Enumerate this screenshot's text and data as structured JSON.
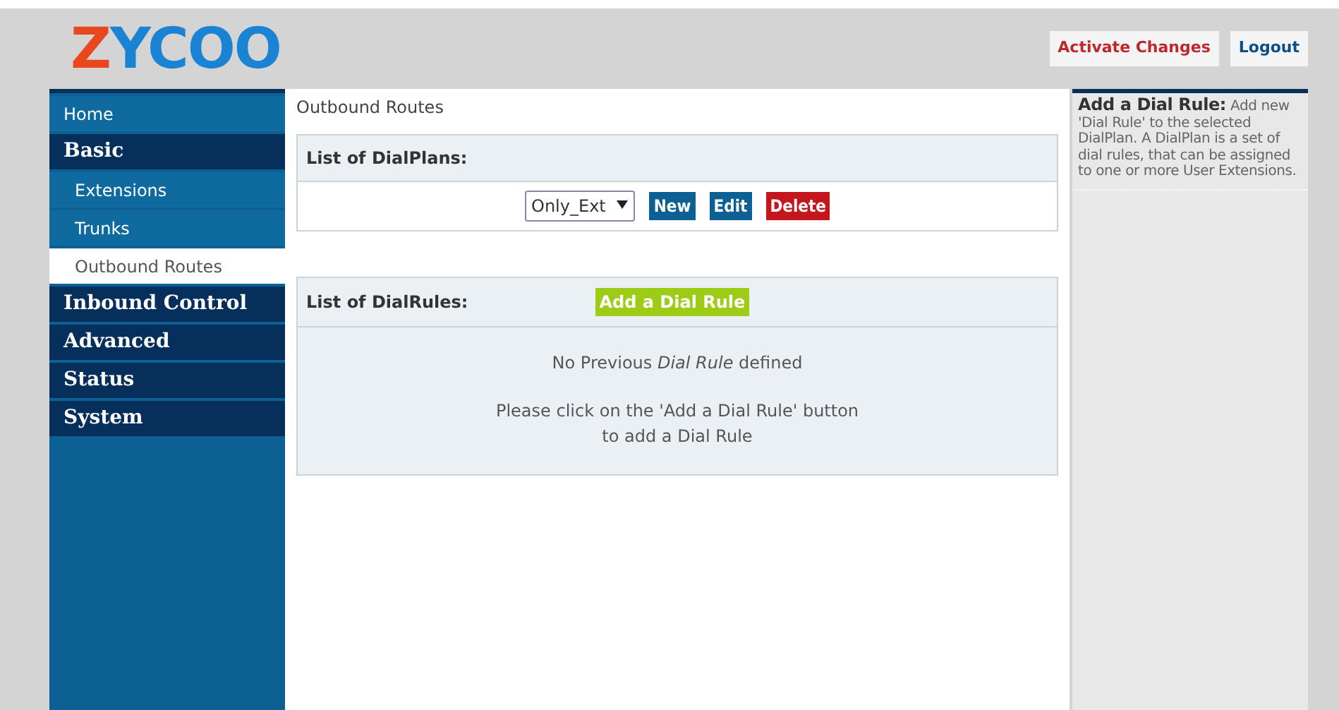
{
  "logo": {
    "parts": [
      {
        "text": "Z",
        "color": "#e9471d"
      },
      {
        "text": "YCOO",
        "color": "#1b83d3"
      }
    ]
  },
  "header_buttons": [
    {
      "label": "Activate Changes",
      "kind": "danger"
    },
    {
      "label": "Logout",
      "kind": "plain"
    }
  ],
  "sidebar": {
    "items": [
      {
        "label": "Home",
        "kind": "link",
        "selected": false
      },
      {
        "label": "Basic",
        "kind": "section",
        "selected": false
      },
      {
        "label": "Extensions",
        "kind": "sub",
        "selected": false
      },
      {
        "label": "Trunks",
        "kind": "sub",
        "selected": false
      },
      {
        "label": "Outbound Routes",
        "kind": "sub",
        "selected": true
      },
      {
        "label": "Inbound Control",
        "kind": "section",
        "selected": false
      },
      {
        "label": "Advanced",
        "kind": "section",
        "selected": false
      },
      {
        "label": "Status",
        "kind": "section",
        "selected": false
      },
      {
        "label": "System",
        "kind": "section",
        "selected": false
      }
    ]
  },
  "breadcrumb": "Outbound Routes",
  "dialplans": {
    "title": "List of DialPlans:",
    "select_value": "Only_Ext",
    "buttons": [
      {
        "label": "New",
        "kind": "blue"
      },
      {
        "label": "Edit",
        "kind": "blue"
      },
      {
        "label": "Delete",
        "kind": "red"
      }
    ]
  },
  "dialrules": {
    "title": "List of DialRules:",
    "add_button": "Add a Dial Rule",
    "empty_message": "No Previous *Dial Rule* defined",
    "hint_lines": [
      "Please click on the 'Add a Dial Rule' button",
      "to add a Dial Rule"
    ]
  },
  "help": {
    "text": "**Add a Dial Rule:** Add new 'Dial Rule' to the selected DialPlan. A DialPlan is a set of dial rules, that can be assigned to one or more User Extensions."
  }
}
